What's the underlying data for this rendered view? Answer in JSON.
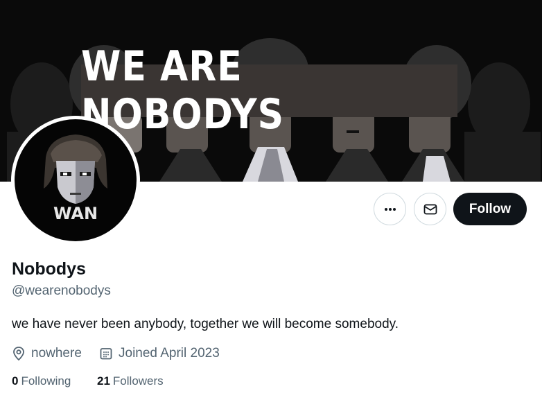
{
  "banner": {
    "title": "WE ARE NOBODYS"
  },
  "avatar": {
    "text": "WAN"
  },
  "actions": {
    "follow_label": "Follow"
  },
  "profile": {
    "name": "Nobodys",
    "handle": "@wearenobodys",
    "bio": "we have never been anybody, together we will become somebody.",
    "location": "nowhere",
    "joined": "Joined April 2023"
  },
  "stats": {
    "following_count": "0",
    "following_label": "Following",
    "followers_count": "21",
    "followers_label": "Followers"
  },
  "icons": {
    "more": "more-icon",
    "message": "mail-icon",
    "location": "location-pin-icon",
    "joined": "calendar-icon"
  },
  "colors": {
    "primary_text": "#0f1419",
    "secondary_text": "#536471",
    "button_border": "#cfd9de",
    "follow_button_bg": "#0f1419"
  }
}
